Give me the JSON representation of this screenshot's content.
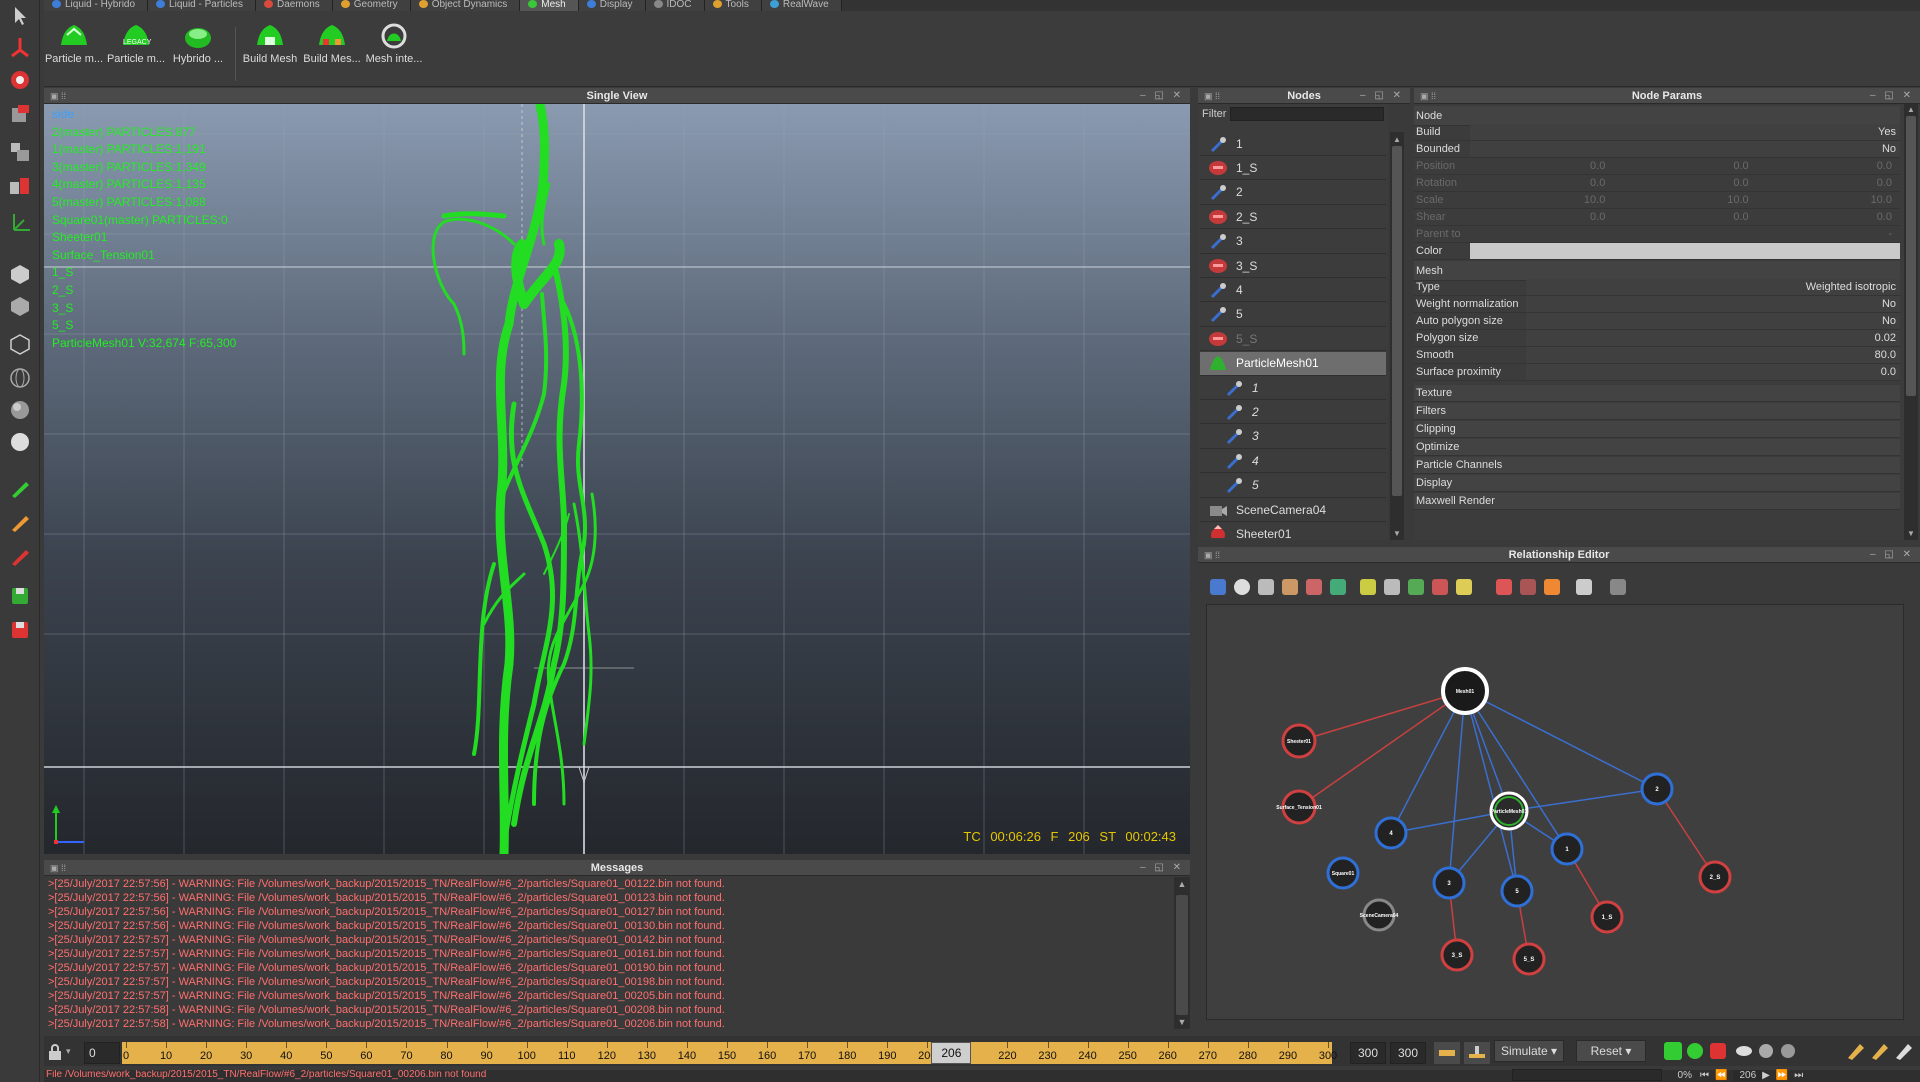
{
  "tabs": [
    {
      "label": "Liquid - Hybrido",
      "color": "#3d7fd8",
      "active": false
    },
    {
      "label": "Liquid - Particles",
      "color": "#3d7fd8",
      "active": false
    },
    {
      "label": "Daemons",
      "color": "#d84a3d",
      "active": false
    },
    {
      "label": "Geometry",
      "color": "#e0a030",
      "active": false
    },
    {
      "label": "Object Dynamics",
      "color": "#e0a030",
      "active": false
    },
    {
      "label": "Mesh",
      "color": "#38c838",
      "active": true
    },
    {
      "label": "Display",
      "color": "#3d7fd8",
      "active": false
    },
    {
      "label": "IDOC",
      "color": "#888888",
      "active": false
    },
    {
      "label": "Tools",
      "color": "#e0a030",
      "active": false
    },
    {
      "label": "RealWave",
      "color": "#3d9fd8",
      "active": false
    }
  ],
  "shelf": {
    "particle_mesh": "Particle m...",
    "particle_mesh_legacy": "Particle m...",
    "legacy_badge": "LEGACY",
    "hybrido_mesh": "Hybrido ...",
    "build_mesh": "Build Mesh",
    "build_meshes": "Build Mes...",
    "mesh_interpolate": "Mesh inte..."
  },
  "viewport": {
    "title": "Single View",
    "info": [
      "side",
      "2(master) PARTICLES:877",
      "1(master) PARTICLES:1,191",
      "3(master) PARTICLES:1,349",
      "4(master) PARTICLES:1,135",
      "5(master) PARTICLES:1,088",
      "Square01(master) PARTICLES:0",
      "Sheeter01",
      "Surface_Tension01",
      "1_S",
      "2_S",
      "3_S",
      "5_S",
      "ParticleMesh01 V:32,674 F:65,300"
    ],
    "hud": "TC 00:06:26   F 206   ST 00:02:43",
    "colors": {
      "fluid": "#22dd22",
      "info_first": "#3aa0ff",
      "hud": "#e6c600"
    }
  },
  "messages": {
    "title": "Messages",
    "lines": [
      ">[25/July/2017 22:57:56] - WARNING: File /Volumes/work_backup/2015/2015_TN/RealFlow/#6_2/particles/Square01_00122.bin not found.",
      ">[25/July/2017 22:57:56] - WARNING: File /Volumes/work_backup/2015/2015_TN/RealFlow/#6_2/particles/Square01_00123.bin not found.",
      ">[25/July/2017 22:57:56] - WARNING: File /Volumes/work_backup/2015/2015_TN/RealFlow/#6_2/particles/Square01_00127.bin not found.",
      ">[25/July/2017 22:57:56] - WARNING: File /Volumes/work_backup/2015/2015_TN/RealFlow/#6_2/particles/Square01_00130.bin not found.",
      ">[25/July/2017 22:57:57] - WARNING: File /Volumes/work_backup/2015/2015_TN/RealFlow/#6_2/particles/Square01_00142.bin not found.",
      ">[25/July/2017 22:57:57] - WARNING: File /Volumes/work_backup/2015/2015_TN/RealFlow/#6_2/particles/Square01_00161.bin not found.",
      ">[25/July/2017 22:57:57] - WARNING: File /Volumes/work_backup/2015/2015_TN/RealFlow/#6_2/particles/Square01_00190.bin not found.",
      ">[25/July/2017 22:57:57] - WARNING: File /Volumes/work_backup/2015/2015_TN/RealFlow/#6_2/particles/Square01_00198.bin not found.",
      ">[25/July/2017 22:57:57] - WARNING: File /Volumes/work_backup/2015/2015_TN/RealFlow/#6_2/particles/Square01_00205.bin not found.",
      ">[25/July/2017 22:57:58] - WARNING: File /Volumes/work_backup/2015/2015_TN/RealFlow/#6_2/particles/Square01_00208.bin not found.",
      ">[25/July/2017 22:57:58] - WARNING: File /Volumes/work_backup/2015/2015_TN/RealFlow/#6_2/particles/Square01_00206.bin not found."
    ]
  },
  "timeline": {
    "start_frame": "0",
    "current_frame": "206",
    "end_a": "300",
    "end_b": "300",
    "ticks": [
      "0",
      "10",
      "20",
      "30",
      "40",
      "50",
      "60",
      "70",
      "80",
      "90",
      "100",
      "110",
      "120",
      "130",
      "140",
      "150",
      "160",
      "170",
      "180",
      "190",
      "200",
      "",
      "220",
      "230",
      "240",
      "250",
      "260",
      "270",
      "280",
      "290",
      "300"
    ],
    "simulate_label": "Simulate",
    "reset_label": "Reset",
    "progress": "0%",
    "frame_field": "206"
  },
  "status_text": "File /Volumes/work_backup/2015/2015_TN/RealFlow/#6_2/particles/Square01_00206.bin not found",
  "nodes": {
    "title": "Nodes",
    "filter_label": "Filter",
    "items": [
      {
        "label": "1",
        "type": "emitter",
        "indent": 0
      },
      {
        "label": "1_S",
        "type": "daemon",
        "indent": 0
      },
      {
        "label": "2",
        "type": "emitter",
        "indent": 0
      },
      {
        "label": "2_S",
        "type": "daemon",
        "indent": 0
      },
      {
        "label": "3",
        "type": "emitter",
        "indent": 0
      },
      {
        "label": "3_S",
        "type": "daemon",
        "indent": 0
      },
      {
        "label": "4",
        "type": "emitter",
        "indent": 0
      },
      {
        "label": "5",
        "type": "emitter",
        "indent": 0
      },
      {
        "label": "5_S",
        "type": "daemon",
        "indent": 0
      },
      {
        "label": "ParticleMesh01",
        "type": "mesh",
        "indent": 0,
        "selected": true
      },
      {
        "label": "1",
        "type": "emitter",
        "indent": 1
      },
      {
        "label": "2",
        "type": "emitter",
        "indent": 1
      },
      {
        "label": "3",
        "type": "emitter",
        "indent": 1
      },
      {
        "label": "4",
        "type": "emitter",
        "indent": 1
      },
      {
        "label": "5",
        "type": "emitter",
        "indent": 1
      },
      {
        "label": "SceneCamera04",
        "type": "camera",
        "indent": 0
      },
      {
        "label": "Sheeter01",
        "type": "sheeter",
        "indent": 0
      }
    ]
  },
  "params": {
    "title": "Node Params",
    "section_node": "Node",
    "node_rows": [
      {
        "name": "Build",
        "value": "Yes"
      },
      {
        "name": "Bounded",
        "value": "No"
      }
    ],
    "vector_rows": [
      {
        "name": "Position",
        "values": [
          "0.0",
          "0.0",
          "0.0"
        ]
      },
      {
        "name": "Rotation",
        "values": [
          "0.0",
          "0.0",
          "0.0"
        ]
      },
      {
        "name": "Scale",
        "values": [
          "10.0",
          "10.0",
          "10.0"
        ]
      },
      {
        "name": "Shear",
        "values": [
          "0.0",
          "0.0",
          "0.0"
        ]
      },
      {
        "name": "Parent to",
        "values": [
          "",
          "",
          "-"
        ]
      }
    ],
    "color_label": "Color",
    "color_value": "#c9c9c9",
    "section_mesh": "Mesh",
    "mesh_rows": [
      {
        "name": "Type",
        "value": "Weighted isotropic"
      },
      {
        "name": "Weight normalization",
        "value": "No"
      },
      {
        "name": "Auto polygon size",
        "value": "No"
      },
      {
        "name": "Polygon size",
        "value": "0.02"
      },
      {
        "name": "Smooth",
        "value": "80.0"
      },
      {
        "name": "Surface proximity",
        "value": "0.0"
      }
    ],
    "sections": [
      "Texture",
      "Filters",
      "Clipping",
      "Optimize",
      "Particle Channels",
      "Display",
      "Maxwell Render"
    ]
  },
  "relationship": {
    "title": "Relationship Editor",
    "nodes": [
      {
        "id": "mesh",
        "label": "Mesh01",
        "kind": "white"
      },
      {
        "id": "sheeter",
        "label": "Sheeter01",
        "kind": "red"
      },
      {
        "id": "surf",
        "label": "Surface_Tension01",
        "kind": "red"
      },
      {
        "id": "pm",
        "label": "ParticleMesh01",
        "kind": "green"
      },
      {
        "id": "n4",
        "label": "4",
        "kind": "blue"
      },
      {
        "id": "n2",
        "label": "2",
        "kind": "blue"
      },
      {
        "id": "n1",
        "label": "1",
        "kind": "blue"
      },
      {
        "id": "n3",
        "label": "3",
        "kind": "blue"
      },
      {
        "id": "n5",
        "label": "5",
        "kind": "blue"
      },
      {
        "id": "sq",
        "label": "Square01",
        "kind": "blue"
      },
      {
        "id": "cam",
        "label": "SceneCamera04",
        "kind": "gray"
      },
      {
        "id": "s3",
        "label": "3_S",
        "kind": "red"
      },
      {
        "id": "s5",
        "label": "5_S",
        "kind": "red"
      },
      {
        "id": "s1",
        "label": "1_S",
        "kind": "red"
      },
      {
        "id": "s2",
        "label": "2_S",
        "kind": "red"
      }
    ]
  }
}
